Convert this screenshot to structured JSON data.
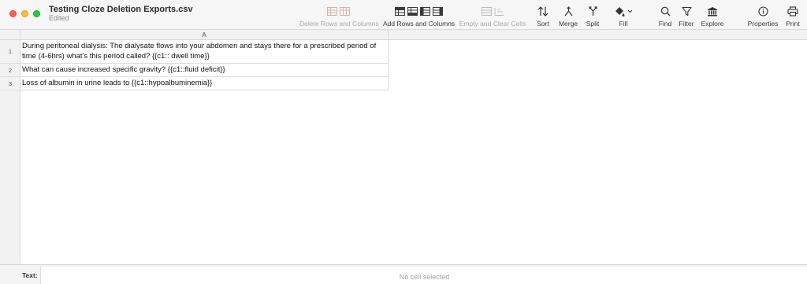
{
  "window": {
    "title": "Testing Cloze Deletion Exports.csv",
    "subtitle": "Edited"
  },
  "toolbar": {
    "delete_rows_cols": "Delete Rows and Columns",
    "add_rows_cols": "Add Rows and Columns",
    "empty_clear": "Empty and Clear Cells",
    "sort": "Sort",
    "merge": "Merge",
    "split": "Split",
    "fill": "Fill",
    "find": "Find",
    "filter": "Filter",
    "explore": "Explore",
    "properties": "Properties",
    "print": "Print"
  },
  "icons": {
    "delete": "delete-rows-columns-icon",
    "add": "add-rows-columns-icon",
    "empty": "empty-clear-icon",
    "sort": "sort-icon",
    "merge": "merge-icon",
    "split": "split-icon",
    "fill": "paint-bucket-icon",
    "find": "magnifier-icon",
    "filter": "funnel-icon",
    "explore": "bank-icon",
    "properties": "info-icon",
    "print": "printer-icon"
  },
  "sheet": {
    "column_header": "A",
    "rows": [
      {
        "num": "1",
        "text": "During peritoneal dialysis: The dialysate flows into your abdomen and stays there for a prescribed period of time (4-6hrs) what's this period called? {{c1:: dwell time}}"
      },
      {
        "num": "2",
        "text": "What can cause increased specific gravity? {{c1::fluid deficit}}"
      },
      {
        "num": "3",
        "text": "Loss of albumin in urine leads to {{c1::hypoalbuminemia}}"
      }
    ]
  },
  "textbar": {
    "label": "Text:",
    "placeholder": "No cell selected"
  },
  "colors": {
    "close": "#fe5f57",
    "minimize": "#febc2e",
    "maximize": "#28c840"
  }
}
